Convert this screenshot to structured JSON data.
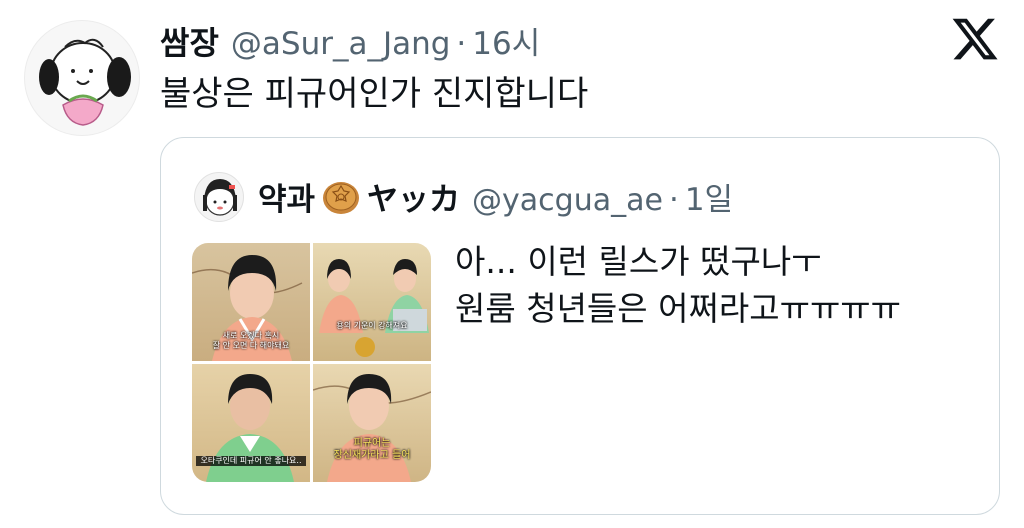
{
  "tweet": {
    "author_name": "쌈장",
    "author_handle": "@aSur_a_Jang",
    "separator": "·",
    "time": "16시",
    "text": "불상은 피규어인가 진지합니다"
  },
  "icons": {
    "logo": "x-logo-icon",
    "author_avatar": "avatar-icon",
    "quote_avatar": "avatar-icon",
    "name_emoji": "mooncake-emoji-icon"
  },
  "quote": {
    "author_name_prefix": "약과",
    "author_name_suffix": "ヤッカ",
    "author_handle": "@yacgua_ae",
    "separator": "·",
    "time": "1일",
    "text_line1": "아... 이런 릴스가 떴구나ㅜ",
    "text_line2": "원룸 청년들은 어쩌라고ㅠㅠㅠㅠ",
    "media_captions": [
      "새로 오겠다 혹시\n잘 안 오면 다 해야돼요",
      "용의 기운이 강해져요",
      "오타쿠인데 피규어 안 좋나요..",
      "피규어는\n장신재가라고 들어"
    ]
  },
  "colors": {
    "text": "#0f1419",
    "secondary": "#536471",
    "border": "#cfd9de"
  }
}
